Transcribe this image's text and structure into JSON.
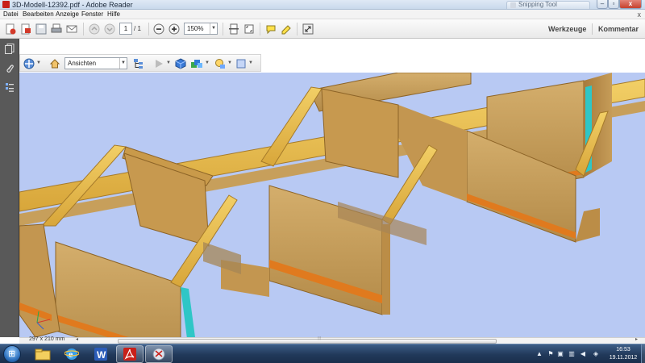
{
  "window": {
    "title": "3D-Modell-12392.pdf - Adobe Reader",
    "background_tab": "Snipping Tool",
    "close_glyph": "x"
  },
  "menu": {
    "items": [
      "Datei",
      "Bearbeiten",
      "Anzeige",
      "Fenster",
      "Hilfe"
    ],
    "close_glyph": "x"
  },
  "toolbar": {
    "current_page": "1",
    "page_total": "/ 1",
    "zoom": "150%",
    "tools_label": "Werkzeuge",
    "comment_label": "Kommentar"
  },
  "toolbar_3d": {
    "views_selected": "Ansichten"
  },
  "status": {
    "page_size": "297 x 210 mm",
    "scroll_left_glyph": "◂",
    "scroll_right_glyph": "▸",
    "scroll_grip": "⦙⦙⦙"
  },
  "taskbar": {
    "time": "16:53",
    "date": "19.11.2012"
  },
  "icons": [
    "app-icon",
    "create-pdf-icon",
    "open-icon",
    "save-icon",
    "print-icon",
    "email-icon",
    "page-up-icon",
    "page-down-icon",
    "zoom-out-icon",
    "zoom-in-icon",
    "fit-page-icon",
    "fit-width-icon",
    "comment-icon",
    "highlight-icon",
    "read-mode-icon",
    "pages-panel-icon",
    "attachments-icon",
    "layers-icon",
    "rotate-3d-icon",
    "home-icon",
    "model-tree-icon",
    "play-icon",
    "render-mode-icon",
    "lighting-icon",
    "background-color-icon",
    "start-orb-icon",
    "explorer-icon",
    "internet-explorer-icon",
    "word-icon",
    "adobe-reader-icon",
    "snipping-tool-icon"
  ],
  "colors": {
    "viewport_bg": "#b8c9f3",
    "wood": "#c9a15c",
    "beam_highlight": "#e8b83a",
    "orange_band": "#e07a1e",
    "cyan_edge": "#2fc6c6"
  }
}
